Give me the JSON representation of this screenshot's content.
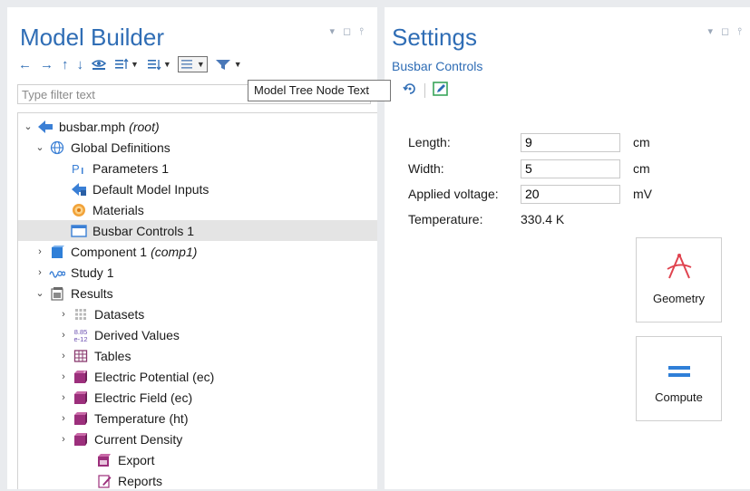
{
  "colors": {
    "accent": "#2f6db5",
    "selected_row": "#e4e4e4",
    "tooltip_border": "#767676"
  },
  "model_builder": {
    "title": "Model Builder",
    "toolbar_icons": [
      "arrow-left-icon",
      "arrow-right-icon",
      "arrow-up-icon",
      "arrow-down-icon",
      "show-icon",
      "sort-icon",
      "expand-icon",
      "model-tree-node-text-icon",
      "dynamic-help-icon"
    ],
    "filter_placeholder": "Type filter text",
    "tooltip": "Model Tree Node Text",
    "tree": [
      {
        "label": "busbar.mph",
        "suffix": "(root)",
        "icon": "model-file-icon"
      },
      {
        "label": "Global Definitions",
        "icon": "globe-icon"
      },
      {
        "label": "Parameters 1",
        "icon": "parameters-icon"
      },
      {
        "label": "Default Model Inputs",
        "icon": "model-inputs-icon"
      },
      {
        "label": "Materials",
        "icon": "materials-icon"
      },
      {
        "label": "Busbar Controls 1",
        "icon": "form-icon",
        "selected": true
      },
      {
        "label": "Component 1",
        "suffix": "(comp1)",
        "icon": "component-icon"
      },
      {
        "label": "Study 1",
        "icon": "study-icon"
      },
      {
        "label": "Results",
        "icon": "results-icon"
      },
      {
        "label": "Datasets",
        "icon": "datasets-icon"
      },
      {
        "label": "Derived Values",
        "icon": "derived-values-icon",
        "icon_text": [
          "8.85",
          "e-12"
        ]
      },
      {
        "label": "Tables",
        "icon": "tables-icon"
      },
      {
        "label": "Electric Potential (ec)",
        "icon": "plot-group-icon"
      },
      {
        "label": "Electric Field (ec)",
        "icon": "plot-group-icon"
      },
      {
        "label": "Temperature (ht)",
        "icon": "plot-group-icon"
      },
      {
        "label": "Current Density",
        "icon": "plot-group-icon"
      },
      {
        "label": "Export",
        "icon": "export-icon"
      },
      {
        "label": "Reports",
        "icon": "reports-icon"
      }
    ]
  },
  "settings": {
    "title": "Settings",
    "subtitle": "Busbar Controls",
    "icons": [
      "refresh-icon",
      "edit-icon"
    ],
    "form": [
      {
        "label": "Length:",
        "value": "9",
        "unit": "cm"
      },
      {
        "label": "Width:",
        "value": "5",
        "unit": "cm"
      },
      {
        "label": "Applied voltage:",
        "value": "20",
        "unit": "mV"
      },
      {
        "label": "Temperature:",
        "display": "330.4 K"
      }
    ],
    "buttons": [
      {
        "label": "Geometry",
        "icon": "compass-icon"
      },
      {
        "label": "Compute",
        "icon": "equals-icon"
      }
    ]
  }
}
